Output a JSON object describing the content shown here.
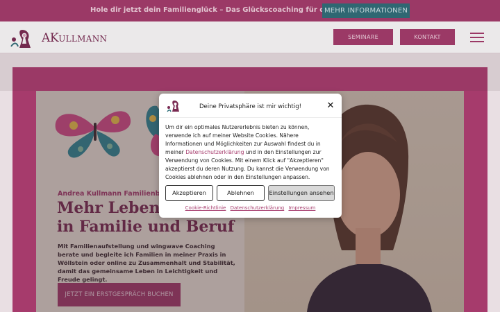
{
  "topbar": {
    "text": "Hole dir jetzt dein Familienglück – Das Glückscoaching für die ganze Familie",
    "button_label": "MEHR INFORMATIONEN"
  },
  "header": {
    "logo_text_a": "A",
    "logo_text_k": "K",
    "logo_text_rest": "ULLMANN",
    "nav": [
      {
        "label": "SEMINARE"
      },
      {
        "label": "KONTAKT"
      }
    ]
  },
  "hero": {
    "kicker": "Andrea Kullmann Familienberatung",
    "headline_line1": "Mehr Leben",
    "headline_line2": "in Familie und Beruf",
    "intro": "Mit Familienaufstellung und wingwave Coaching berate und begleite ich Familien in meiner Praxis in Wöllstein oder online zu Zusammenhalt und Stabilität, damit das gemeinsame Leben in Leichtigkeit und Freude gelingt.",
    "cta_label": "JETZT EIN ERSTGESPRÄCH BUCHEN"
  },
  "cookie_modal": {
    "title": "Deine Privatsphäre ist mir wichtig!",
    "close_symbol": "✕",
    "body_part1": "Um dir ein optimales Nutzererlebnis bieten zu können, verwende ich auf meiner Website Cookies. Nähere Informationen und Möglichkeiten zur Auswahl findest du in meiner ",
    "body_link": "Datenschutzerklärung",
    "body_part2": " und in den Einstellungen zur Verwendung von Cookies. Mit einem Klick auf \"Akzeptieren\" akzeptierst du deren Nutzung. Du kannst die Verwendung von Cookies ablehnen oder in den Einstellungen anpassen.",
    "buttons": {
      "accept": "Akzeptieren",
      "decline": "Ablehnen",
      "settings": "Einstellungen ansehen"
    },
    "links": [
      "Cookie-Richtlinie",
      "Datenschutzerklärung",
      "Impressum"
    ]
  },
  "colors": {
    "brand": "#a63b6c",
    "brand_dark": "#7a2a52",
    "teal": "#2e6f7a"
  }
}
